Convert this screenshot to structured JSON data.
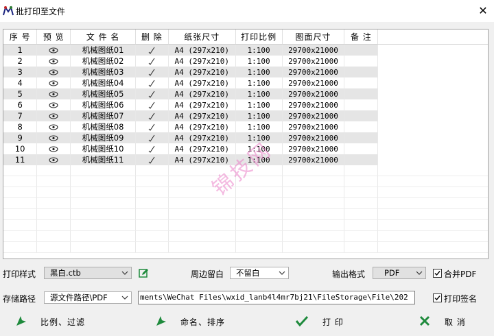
{
  "window": {
    "title": "批打印至文件",
    "close_glyph": "✕"
  },
  "table": {
    "headers": [
      "序 号",
      "预 览",
      "文 件 名",
      "删 除",
      "纸张尺寸",
      "打印比例",
      "图面尺寸",
      "备 注"
    ],
    "rows": [
      [
        "1",
        "机械图纸01",
        "A4 (297x210)",
        "1:100",
        "29700x21000"
      ],
      [
        "2",
        "机械图纸02",
        "A4 (297x210)",
        "1:100",
        "29700x21000"
      ],
      [
        "3",
        "机械图纸03",
        "A4 (297x210)",
        "1:100",
        "29700x21000"
      ],
      [
        "4",
        "机械图纸04",
        "A4 (297x210)",
        "1:100",
        "29700x21000"
      ],
      [
        "5",
        "机械图纸05",
        "A4 (297x210)",
        "1:100",
        "29700x21000"
      ],
      [
        "6",
        "机械图纸06",
        "A4 (297x210)",
        "1:100",
        "29700x21000"
      ],
      [
        "7",
        "机械图纸07",
        "A4 (297x210)",
        "1:100",
        "29700x21000"
      ],
      [
        "8",
        "机械图纸08",
        "A4 (297x210)",
        "1:100",
        "29700x21000"
      ],
      [
        "9",
        "机械图纸09",
        "A4 (297x210)",
        "1:100",
        "29700x21000"
      ],
      [
        "10",
        "机械图纸10",
        "A4 (297x210)",
        "1:100",
        "29700x21000"
      ],
      [
        "11",
        "机械图纸11",
        "A4 (297x210)",
        "1:100",
        "29700x21000"
      ]
    ],
    "preview_icon": "eye-icon",
    "delete_icon": "check-mark-icon"
  },
  "watermark": "锦技网",
  "settings": {
    "print_style_label": "打印样式",
    "print_style_value": "黑白.ctb",
    "margin_label": "周边留白",
    "margin_value": "不留白",
    "output_format_label": "输出格式",
    "output_format_value": "PDF",
    "merge_pdf_label": "合并PDF",
    "merge_pdf_checked": true,
    "save_path_label": "存储路径",
    "save_path_mode": "源文件路径\\PDF",
    "save_path_value": "ments\\WeChat Files\\wxid_lanb4l4mr7bj21\\FileStorage\\File\\202",
    "print_sign_label": "打印签名",
    "print_sign_checked": true
  },
  "buttons": {
    "scale_filter": "比例、过滤",
    "rename_sort": "命名、排序",
    "print": "打 印",
    "cancel": "取 消"
  },
  "colors": {
    "accent_green": "#1e8a3c",
    "row_alt": "#e5e5e5",
    "watermark": "#eb82c8"
  }
}
